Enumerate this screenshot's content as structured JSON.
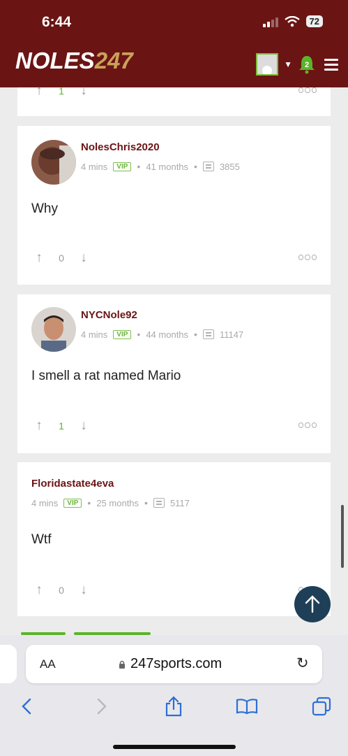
{
  "status_bar": {
    "time": "6:44",
    "battery": "72"
  },
  "header": {
    "logo_text": "NOLES",
    "logo_num": "247",
    "notifications_count": "2",
    "colors": {
      "brand": "#6b1414",
      "gold": "#c9a25a",
      "accent_green": "#5cb42a"
    }
  },
  "partial_card": {
    "vote_count": "1"
  },
  "comments": [
    {
      "username": "NolesChris2020",
      "time": "4 mins",
      "badge": "VIP",
      "tenure": "41 months",
      "post_count": "3855",
      "text": "Why",
      "votes": "0"
    },
    {
      "username": "NYCNole92",
      "time": "4 mins",
      "badge": "VIP",
      "tenure": "44 months",
      "post_count": "11147",
      "text": "I smell a rat named Mario",
      "votes": "1"
    },
    {
      "username": "Floridastate4eva",
      "time": "4 mins",
      "badge": "VIP",
      "tenure": "25 months",
      "post_count": "5117",
      "text": "Wtf",
      "votes": "0"
    }
  ],
  "browser": {
    "text_size_label": "AA",
    "url": "247sports.com"
  },
  "icons": {
    "back": "chevron-left-icon",
    "forward": "chevron-right-icon",
    "share": "share-icon",
    "bookmarks": "book-icon",
    "tabs": "tabs-icon"
  }
}
